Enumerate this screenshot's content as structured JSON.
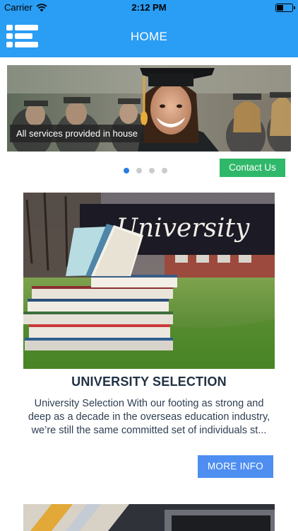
{
  "status": {
    "carrier": "Carrier",
    "time": "2:12 PM"
  },
  "header": {
    "title": "HOME"
  },
  "banner": {
    "caption": "All services provided in house",
    "slide_count": 4,
    "active_slide": 1
  },
  "contact": {
    "label": "Contact Us"
  },
  "card": {
    "image_text": "University",
    "title": "UNIVERSITY SELECTION",
    "description": "University Selection With our footing as strong and deep as a decade in the overseas education industry, we’re still the same committed set of individuals st...",
    "button_label": "MORE INFO"
  },
  "colors": {
    "primary": "#2a9df4",
    "contact_button": "#2fb86a",
    "more_button": "#4d8ef0",
    "active_dot": "#2a7de1",
    "inactive_dot": "#cccccc"
  }
}
